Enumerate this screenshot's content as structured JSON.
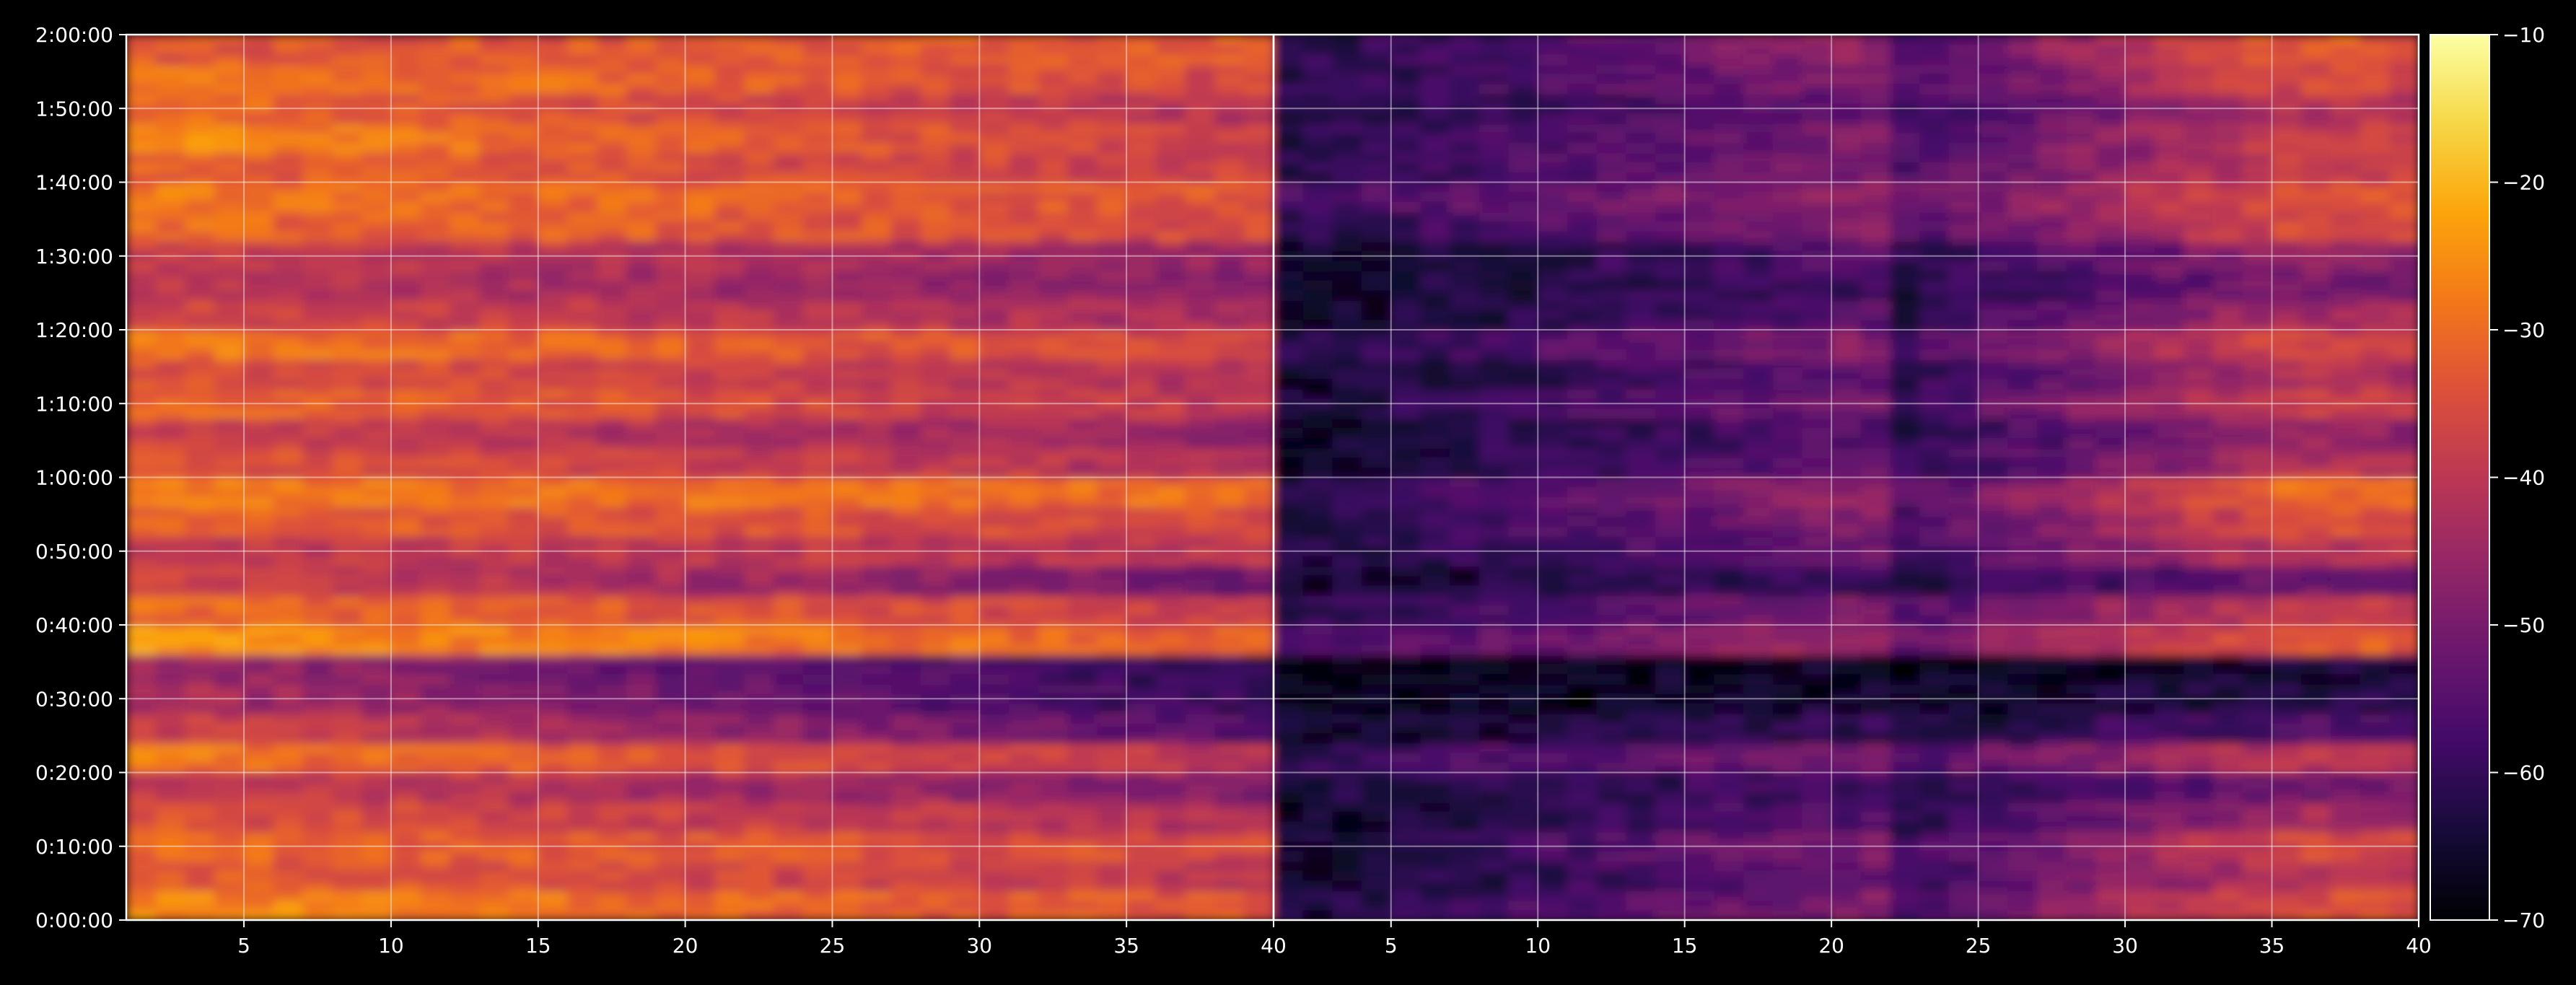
{
  "chart_data": {
    "type": "heatmap",
    "title": "",
    "xlabel": "",
    "ylabel": "",
    "panels": [
      {
        "name": "",
        "xlim": [
          1,
          40
        ],
        "x_ticks": [
          "5",
          "10",
          "15",
          "20",
          "25",
          "30",
          "35",
          "40"
        ],
        "x_tick_values": [
          5,
          10,
          15,
          20,
          25,
          30,
          35,
          40
        ]
      },
      {
        "name": "",
        "xlim": [
          1,
          40
        ],
        "x_ticks": [
          "5",
          "10",
          "15",
          "20",
          "25",
          "30",
          "35",
          "40"
        ],
        "x_tick_values": [
          5,
          10,
          15,
          20,
          25,
          30,
          35,
          40
        ]
      }
    ],
    "y_range_minutes": [
      0,
      120
    ],
    "y_ticks": [
      "0:00:00",
      "0:10:00",
      "0:20:00",
      "0:30:00",
      "0:40:00",
      "0:50:00",
      "1:00:00",
      "1:10:00",
      "1:20:00",
      "1:30:00",
      "1:40:00",
      "1:50:00",
      "2:00:00"
    ],
    "y_tick_values": [
      0,
      10,
      20,
      30,
      40,
      50,
      60,
      70,
      80,
      90,
      100,
      110,
      120
    ],
    "grid": true,
    "colormap": "inferno",
    "colorbar": {
      "range": [
        -70,
        -10
      ],
      "ticks": [
        "−70",
        "−60",
        "−50",
        "−40",
        "−30",
        "−20",
        "−10"
      ],
      "tick_values": [
        -70,
        -60,
        -50,
        -40,
        -30,
        -20,
        -10
      ]
    },
    "row_levels": {
      "y_step_minutes": 4,
      "y_minutes": [
        0,
        4,
        8,
        12,
        16,
        20,
        24,
        28,
        32,
        36,
        40,
        44,
        48,
        52,
        56,
        60,
        64,
        68,
        72,
        76,
        80,
        84,
        88,
        92,
        96,
        100,
        104,
        108,
        112,
        116
      ],
      "panel_1_left_db": [
        -26,
        -32,
        -30,
        -34,
        -38,
        -28,
        -36,
        -42,
        -44,
        -24,
        -30,
        -36,
        -40,
        -32,
        -28,
        -34,
        -38,
        -30,
        -34,
        -28,
        -36,
        -40,
        -38,
        -30,
        -28,
        -32,
        -26,
        -30,
        -28,
        -34
      ],
      "panel_1_right_db": [
        -34,
        -40,
        -36,
        -42,
        -50,
        -40,
        -56,
        -60,
        -62,
        -32,
        -38,
        -52,
        -40,
        -36,
        -30,
        -42,
        -46,
        -40,
        -42,
        -36,
        -44,
        -48,
        -46,
        -36,
        -34,
        -38,
        -38,
        -42,
        -36,
        -32
      ],
      "panel_2_left_db": [
        -64,
        -66,
        -64,
        -66,
        -64,
        -60,
        -66,
        -68,
        -68,
        -58,
        -62,
        -66,
        -64,
        -64,
        -62,
        -66,
        -66,
        -64,
        -66,
        -62,
        -66,
        -66,
        -66,
        -62,
        -58,
        -62,
        -62,
        -64,
        -62,
        -62
      ],
      "panel_2_right_db": [
        -34,
        -40,
        -36,
        -44,
        -52,
        -40,
        -56,
        -62,
        -64,
        -32,
        -38,
        -52,
        -40,
        -34,
        -30,
        -42,
        -46,
        -38,
        -42,
        -36,
        -44,
        -50,
        -46,
        -36,
        -34,
        -38,
        -38,
        -42,
        -36,
        -32
      ]
    }
  }
}
